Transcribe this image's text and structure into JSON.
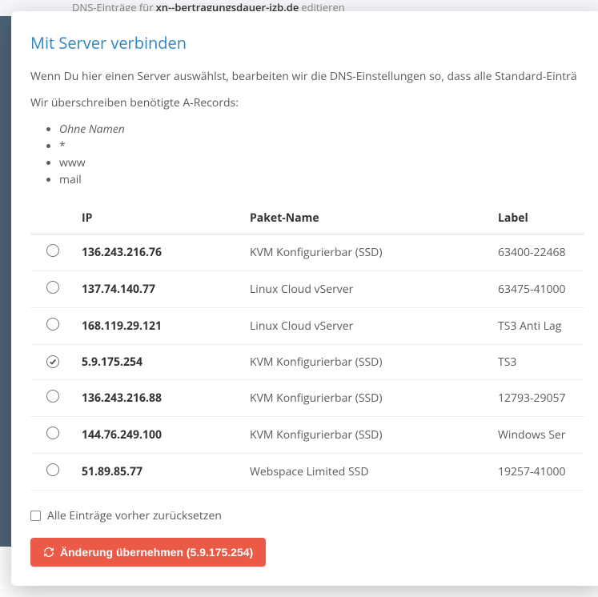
{
  "bg_strip": {
    "prefix": "DNS-Einträge für ",
    "domain": "xn--bertragungsdauer-izb.de",
    "suffix": " editieren"
  },
  "modal": {
    "title": "Mit Server verbinden",
    "intro": {
      "line1": "Wenn Du hier einen Server auswählst, bearbeiten wir die DNS-Einstellungen so, dass alle Standard-Einträ",
      "line2": "Wir überschreiben benötigte A-Records:",
      "records": [
        "Ohne Namen",
        "*",
        "www",
        "mail"
      ],
      "record0_italic": true
    },
    "table": {
      "headers": {
        "ip": "IP",
        "pkg": "Paket-Name",
        "label": "Label"
      },
      "rows": [
        {
          "ip": "136.243.216.76",
          "pkg": "KVM Konfigurierbar (SSD)",
          "label": "63400-22468",
          "selected": false
        },
        {
          "ip": "137.74.140.77",
          "pkg": "Linux Cloud vServer",
          "label": "63475-41000",
          "selected": false
        },
        {
          "ip": "168.119.29.121",
          "pkg": "Linux Cloud vServer",
          "label": "TS3 Anti Lag",
          "selected": false
        },
        {
          "ip": "5.9.175.254",
          "pkg": "KVM Konfigurierbar (SSD)",
          "label": "TS3",
          "selected": true
        },
        {
          "ip": "136.243.216.88",
          "pkg": "KVM Konfigurierbar (SSD)",
          "label": "12793-29057",
          "selected": false
        },
        {
          "ip": "144.76.249.100",
          "pkg": "KVM Konfigurierbar (SSD)",
          "label": "Windows Ser",
          "selected": false
        },
        {
          "ip": "51.89.85.77",
          "pkg": "Webspace Limited SSD",
          "label": "19257-41000",
          "selected": false
        }
      ]
    },
    "reset_checkbox": {
      "label": "Alle Einträge vorher zurücksetzen",
      "checked": false
    },
    "apply_button": {
      "label": "Änderung übernehmen (5.9.175.254)"
    }
  }
}
